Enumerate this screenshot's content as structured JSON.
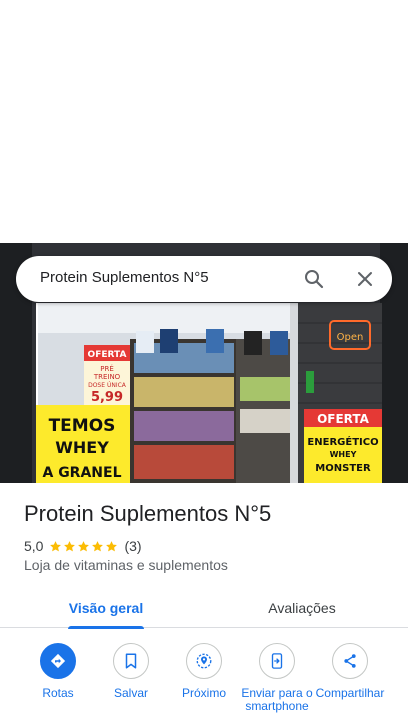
{
  "search": {
    "query": "Protein Suplementos N°5"
  },
  "place": {
    "name": "Protein Suplementos N°5",
    "rating": "5,0",
    "stars": 5,
    "review_count": "(3)",
    "category": "Loja de vitaminas e suplementos"
  },
  "photo_signs": {
    "left_sign": [
      "TEMOS",
      "WHEY",
      "A GRANEL"
    ],
    "oferta_small": "OFERTA",
    "pretreino": [
      "PRÉ",
      "TREINO",
      "DOSE ÚNICA"
    ],
    "pretreino_price": "5,99",
    "oferta_right": "OFERTA",
    "energetico": [
      "ENERGÉTICO",
      "WHEY",
      "MONSTER"
    ]
  },
  "tabs": [
    {
      "label": "Visão geral",
      "active": true
    },
    {
      "label": "Avaliações",
      "active": false
    }
  ],
  "actions": [
    {
      "label": "Rotas",
      "icon": "directions-icon"
    },
    {
      "label": "Salvar",
      "icon": "bookmark-icon"
    },
    {
      "label": "Próximo",
      "icon": "nearby-icon"
    },
    {
      "label": "Enviar para o smartphone",
      "icon": "send-to-phone-icon"
    },
    {
      "label": "Compartilhar",
      "icon": "share-icon"
    }
  ],
  "colors": {
    "accent": "#1a73e8",
    "star": "#fbbc04",
    "oferta_red": "#e53935",
    "sign_yellow": "#fdea2c"
  }
}
